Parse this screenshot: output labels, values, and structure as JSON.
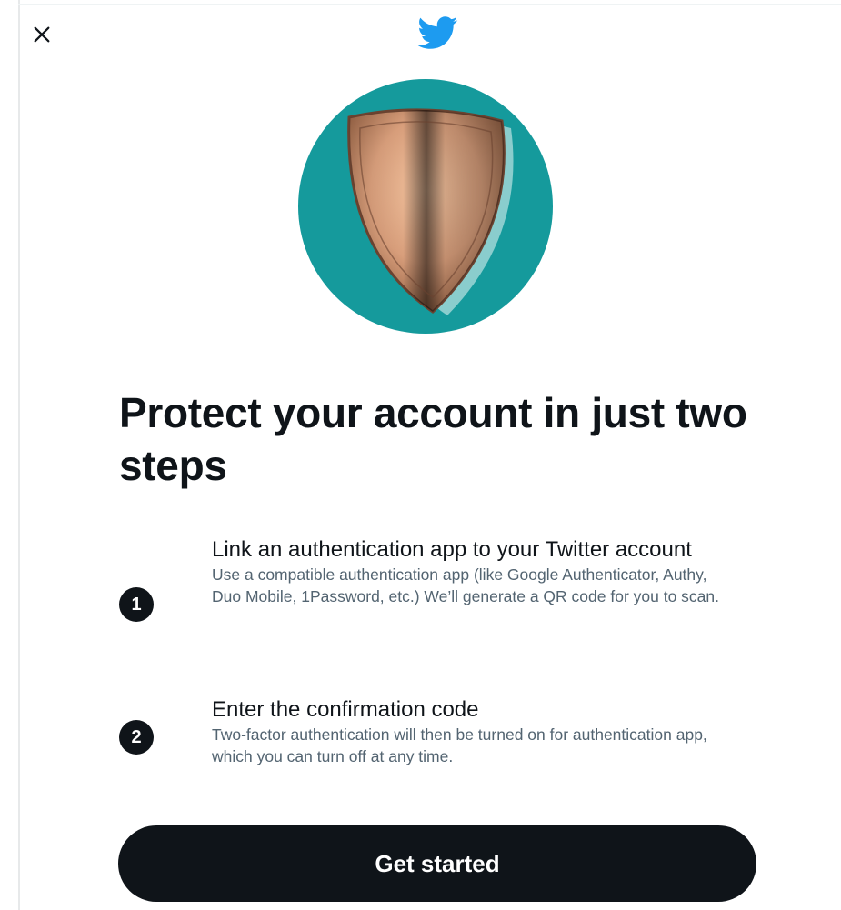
{
  "header": {
    "close_icon": "close-icon",
    "logo_icon": "twitter-bird-icon",
    "brand_color": "#1d9bf0"
  },
  "hero": {
    "icon": "shield-icon",
    "circle_color": "#159a9c"
  },
  "headline": "Protect your account in just two steps",
  "steps": [
    {
      "number": "1",
      "title": "Link an authentication app to your Twitter account",
      "description": "Use a compatible authentication app (like Google Authenticator, Authy, Duo Mobile, 1Password, etc.) We’ll generate a QR code for you to scan."
    },
    {
      "number": "2",
      "title": "Enter the confirmation code",
      "description": "Two-factor authentication will then be turned on for authentication app, which you can turn off at any time."
    }
  ],
  "cta": {
    "label": "Get started",
    "color": "#0f1419"
  }
}
